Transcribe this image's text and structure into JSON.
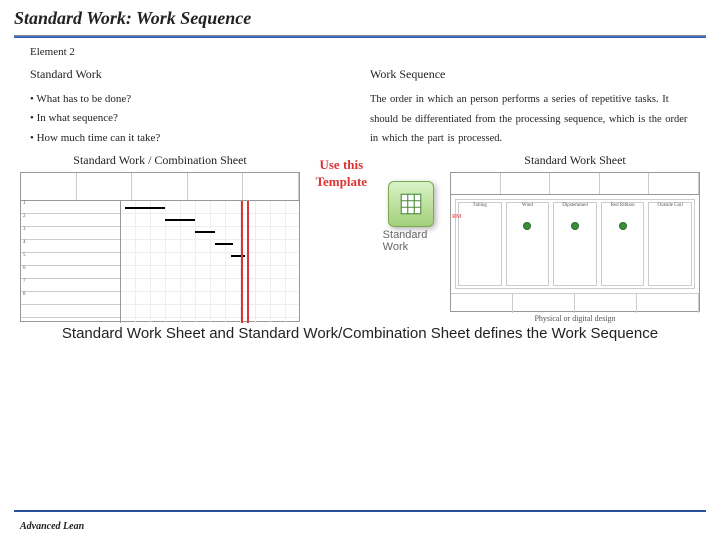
{
  "title": "Standard Work: Work Sequence",
  "subhead": "Element 2",
  "left": {
    "head": "Standard Work",
    "items": [
      "What has to be done?",
      "In what sequence?",
      "How much time can it take?"
    ]
  },
  "right": {
    "head": "Work Sequence",
    "body": "The order in which an person performs a series of repetitive tasks. It should be differentiated from the processing sequence, which is the order in which the part is processed."
  },
  "sheets": {
    "combo_title": "Standard Work / Combination Sheet",
    "sws_title": "Standard Work Sheet",
    "use_template": "Use this Template",
    "excel_label": "Standard Work",
    "physical_note": "Physical or digital design"
  },
  "caption": "Standard Work Sheet and Standard Work/Combination Sheet defines the Work Sequence",
  "brand": "Advanced Lean",
  "icons": {
    "excel": "excel-icon"
  }
}
